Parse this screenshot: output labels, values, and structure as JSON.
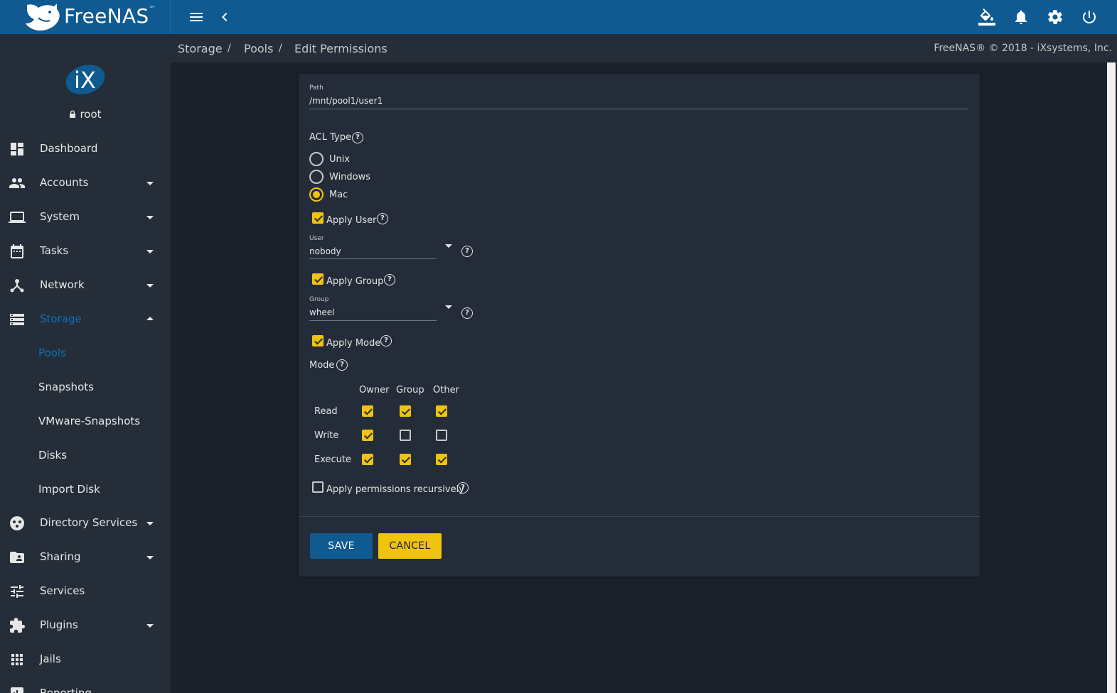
{
  "app": {
    "brand": "FreeNAS",
    "copyright": "FreeNAS® © 2018 - iXsystems, Inc."
  },
  "user": {
    "name": "root"
  },
  "breadcrumb": [
    "Storage",
    "Pools",
    "Edit Permissions"
  ],
  "sidebar": {
    "items": [
      {
        "label": "Dashboard",
        "icon": "dashboard-icon"
      },
      {
        "label": "Accounts",
        "icon": "people-icon"
      },
      {
        "label": "System",
        "icon": "laptop-icon"
      },
      {
        "label": "Tasks",
        "icon": "calendar-icon"
      },
      {
        "label": "Network",
        "icon": "network-icon"
      },
      {
        "label": "Storage",
        "icon": "storage-icon"
      }
    ],
    "storage_sub": [
      "Pools",
      "Snapshots",
      "VMware-Snapshots",
      "Disks",
      "Import Disk"
    ],
    "items2": [
      {
        "label": "Directory Services",
        "icon": "directory-icon"
      },
      {
        "label": "Sharing",
        "icon": "folder-shared-icon"
      },
      {
        "label": "Services",
        "icon": "tune-icon"
      },
      {
        "label": "Plugins",
        "icon": "extension-icon"
      },
      {
        "label": "Jails",
        "icon": "apps-icon"
      },
      {
        "label": "Reporting",
        "icon": "reporting-icon"
      }
    ]
  },
  "form": {
    "path_label": "Path",
    "path_value": "/mnt/pool1/user1",
    "acl_type_label": "ACL Type",
    "acl_options": [
      "Unix",
      "Windows",
      "Mac"
    ],
    "acl_selected": "Mac",
    "apply_user_label": "Apply User",
    "user_label": "User",
    "user_value": "nobody",
    "apply_group_label": "Apply Group",
    "group_label": "Group",
    "group_value": "wheel",
    "apply_mode_label": "Apply Mode",
    "mode_label": "Mode",
    "mode_columns": [
      "Owner",
      "Group",
      "Other"
    ],
    "mode_rows": [
      {
        "label": "Read",
        "values": [
          true,
          true,
          true
        ]
      },
      {
        "label": "Write",
        "values": [
          true,
          false,
          false
        ]
      },
      {
        "label": "Execute",
        "values": [
          true,
          true,
          true
        ]
      }
    ],
    "apply_recursive_label": "Apply permissions recursively",
    "apply_recursive": false,
    "save_label": "SAVE",
    "cancel_label": "CANCEL"
  },
  "colors": {
    "topbar": "#0e5a91",
    "sidebar": "#252d38",
    "background": "#1a212b",
    "card": "#232c38",
    "accent_yellow": "#f0c30f",
    "active_blue": "#0e72bd"
  }
}
